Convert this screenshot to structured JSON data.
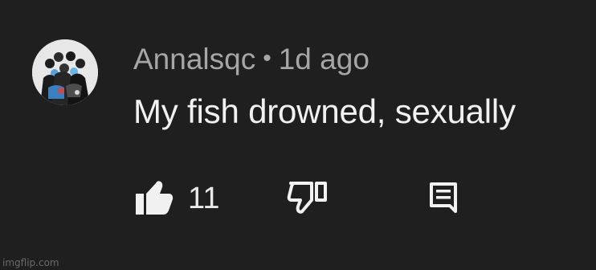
{
  "comment": {
    "author": "Annalsqc",
    "separator": "•",
    "time": "1d ago",
    "text": "My fish drowned, sexually",
    "avatar_icon": "group-photo-avatar"
  },
  "actions": {
    "like_icon": "thumbs-up-filled-icon",
    "like_count": "11",
    "dislike_icon": "thumbs-down-outline-icon",
    "reply_icon": "comment-reply-icon"
  },
  "watermark": "imgflip.com",
  "colors": {
    "background": "#1f1f1f",
    "text_primary": "#f1f1f1",
    "text_secondary": "#a6a6a6",
    "icon": "#f1f1f1"
  }
}
